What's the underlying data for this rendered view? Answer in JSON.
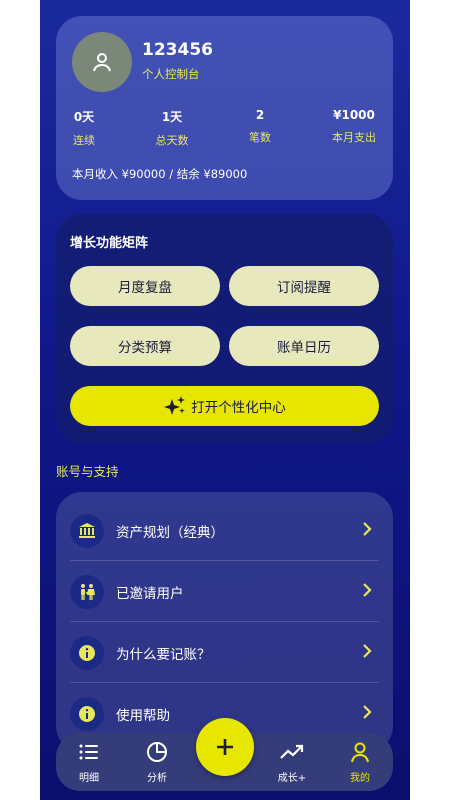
{
  "profile": {
    "username": "123456",
    "subtitle": "个人控制台",
    "stats": [
      {
        "value": "0天",
        "label": "连续"
      },
      {
        "value": "1天",
        "label": "总天数"
      },
      {
        "value": "2",
        "label": "笔数"
      },
      {
        "value": "¥1000",
        "label": "本月支出"
      }
    ],
    "income_summary": "本月收入 ¥90000 / 结余 ¥89000"
  },
  "growth": {
    "title": "增长功能矩阵",
    "buttons": [
      "月度复盘",
      "订阅提醒",
      "分类预算",
      "账单日历"
    ],
    "primary_button": "打开个性化中心"
  },
  "support": {
    "section_title": "账号与支持",
    "items": [
      {
        "label": "资产规划（经典）",
        "icon": "bank-icon"
      },
      {
        "label": "已邀请用户",
        "icon": "users-icon"
      },
      {
        "label": "为什么要记账？",
        "icon": "info-icon"
      },
      {
        "label": "使用帮助",
        "icon": "info-icon"
      }
    ]
  },
  "nav": {
    "items": [
      "明细",
      "分析",
      "成长+",
      "我的"
    ],
    "active": "我的"
  },
  "colors": {
    "accent": "#e6e600",
    "accent_text": "#e6e85a",
    "background": "#10188a"
  }
}
